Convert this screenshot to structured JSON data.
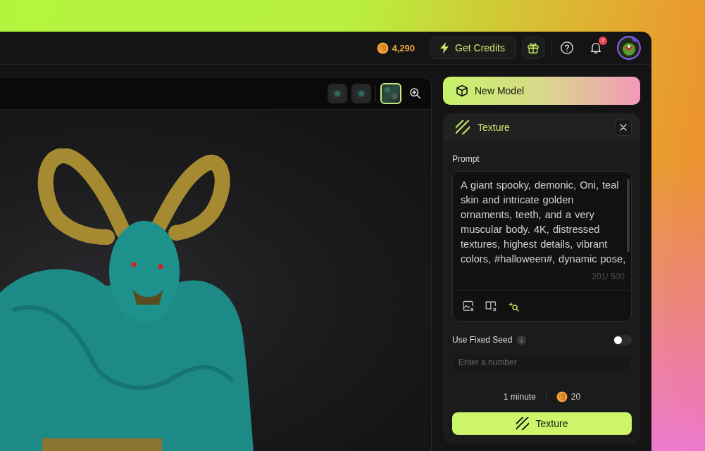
{
  "header": {
    "credits": "4,290",
    "get_credits_button": "Get Credits",
    "notification_count": "7"
  },
  "viewer": {
    "thumbnails": [
      {
        "kind": "model",
        "selected": false
      },
      {
        "kind": "model",
        "selected": false
      },
      {
        "kind": "texture",
        "selected": true
      }
    ]
  },
  "new_model_button": "New Model",
  "texture_panel": {
    "title": "Texture",
    "prompt": {
      "label": "Prompt",
      "value": "A giant spooky, demonic, Oni, teal skin and intricate golden ornaments, teeth, and a very muscular body. 4K, distressed textures, highest details, vibrant colors, #halloween#, dynamic pose,",
      "counter": "201/ 500"
    },
    "fixed_seed": {
      "label": "Use Fixed Seed",
      "on": false,
      "placeholder": "Enter a number"
    },
    "estimate": {
      "time": "1 minute",
      "cost": "20"
    },
    "submit_button": "Texture"
  }
}
